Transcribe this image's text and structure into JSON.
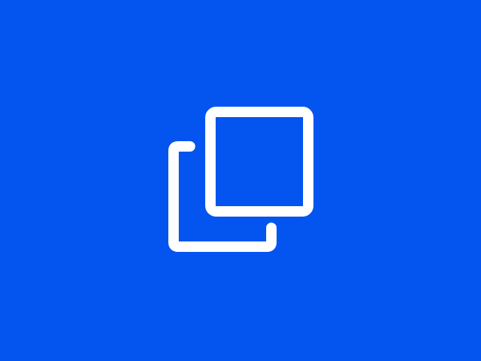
{
  "background_color": "#0455f0",
  "icon": {
    "name": "copy-icon",
    "color": "#ffffff"
  }
}
